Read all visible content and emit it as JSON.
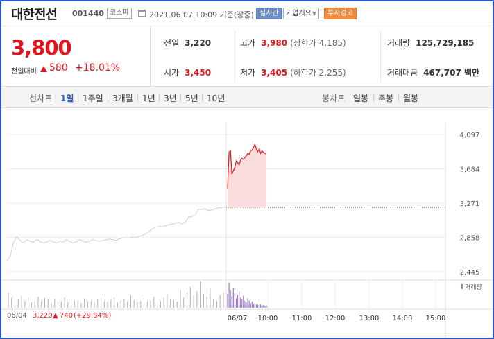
{
  "header": {
    "stock_name": "대한전선",
    "stock_code": "001440",
    "market_badge": "코스피",
    "date_time": "2021.06.07 10:09 기준(장중)",
    "live_button": "실시간",
    "company_info_button": "기업개요",
    "warning_button": "투자경고"
  },
  "price": {
    "current": "3,800",
    "change_label": "전일대비",
    "change_value": "580",
    "change_pct": "+18.01%"
  },
  "stats": {
    "prev_close_label": "전일",
    "prev_close": "3,220",
    "open_label": "시가",
    "open": "3,450",
    "high_label": "고가",
    "high": "3,980",
    "upper_limit": "(상한가 4,185)",
    "low_label": "저가",
    "low": "3,405",
    "lower_limit": "(하한가 2,255)",
    "volume_label": "거래량",
    "volume": "125,729,185",
    "value_label": "거래대금",
    "value": "467,707 백만"
  },
  "tabs": {
    "line_chart_title": "선차트",
    "periods": [
      "1일",
      "1주일",
      "3개월",
      "1년",
      "3년",
      "5년",
      "10년"
    ],
    "active_period": "1일",
    "candle_chart_title": "봉차트",
    "candles": [
      "일봉",
      "주봉",
      "월봉"
    ]
  },
  "footer": {
    "prev_date": "06/04",
    "prev_price": "3,220",
    "prev_change": "740",
    "prev_pct": "(+29.84%)"
  },
  "colors": {
    "up": "#e1161d",
    "accent": "#2b56c6",
    "prev_line": "#cfcfcf",
    "volume_prev": "#b0b0b0",
    "volume_today": "#9b7fc8"
  },
  "chart_data": {
    "type": "line",
    "ylabels": [
      "4,097",
      "3,684",
      "3,271",
      "2,858",
      "2,445"
    ],
    "ylim": [
      2445,
      4097
    ],
    "yticks": [
      4097,
      3684,
      3271,
      2858,
      2445
    ],
    "reference_price": 3220,
    "xlabels": [
      "06/07",
      "10:00",
      "11:00",
      "12:00",
      "13:00",
      "14:00",
      "15:00"
    ],
    "volume_label": "거래량",
    "series": [
      {
        "values": [
          2580,
          2630,
          2800,
          2870,
          2820,
          2790,
          2830,
          2815,
          2800,
          2830,
          2810,
          2790,
          2800,
          2825,
          2805,
          2790,
          2815,
          2800,
          2830,
          2815,
          2790,
          2805,
          2830,
          2815,
          2800,
          2810,
          2835,
          2820,
          2810,
          2820,
          2830,
          2840,
          2830,
          2825,
          2840,
          2850,
          2855,
          2850,
          2860,
          2855,
          2870,
          2880,
          2900,
          2930,
          2960,
          2980,
          2990,
          2985,
          3000,
          3010,
          3015,
          3030,
          3040,
          3020,
          3040,
          3100,
          3110,
          3130,
          3200,
          3195,
          3205,
          3180,
          3190,
          3200,
          3215,
          3220,
          3225
        ]
      },
      {
        "values": [
          3450,
          3880,
          3900,
          3620,
          3660,
          3700,
          3780,
          3760,
          3730,
          3790,
          3810,
          3800,
          3820,
          3840,
          3870,
          3860,
          3900,
          3910,
          3940,
          3980,
          3920,
          3890,
          3930,
          3870,
          3900,
          3880,
          3870,
          3860
        ]
      }
    ],
    "volume_prev": [
      22,
      14,
      20,
      12,
      17,
      10,
      15,
      8,
      11,
      16,
      9,
      14,
      12,
      7,
      13,
      10,
      9,
      15,
      8,
      12,
      10,
      11,
      7,
      13,
      9,
      10,
      8,
      12,
      15,
      10,
      9,
      11,
      14,
      8,
      10,
      12,
      9,
      18,
      11,
      8,
      10,
      13,
      9,
      11,
      16,
      12,
      10,
      14,
      20,
      12,
      11,
      9,
      26,
      15,
      22,
      30,
      18,
      24,
      38,
      20,
      16,
      28,
      12,
      10,
      18,
      22
    ],
    "volume_today": [
      30,
      55,
      38,
      25,
      42,
      33,
      20,
      28,
      35,
      22,
      18,
      26,
      15,
      12,
      20,
      16,
      10,
      14,
      9,
      11,
      8,
      7,
      6,
      8,
      5,
      6,
      4,
      5
    ]
  }
}
